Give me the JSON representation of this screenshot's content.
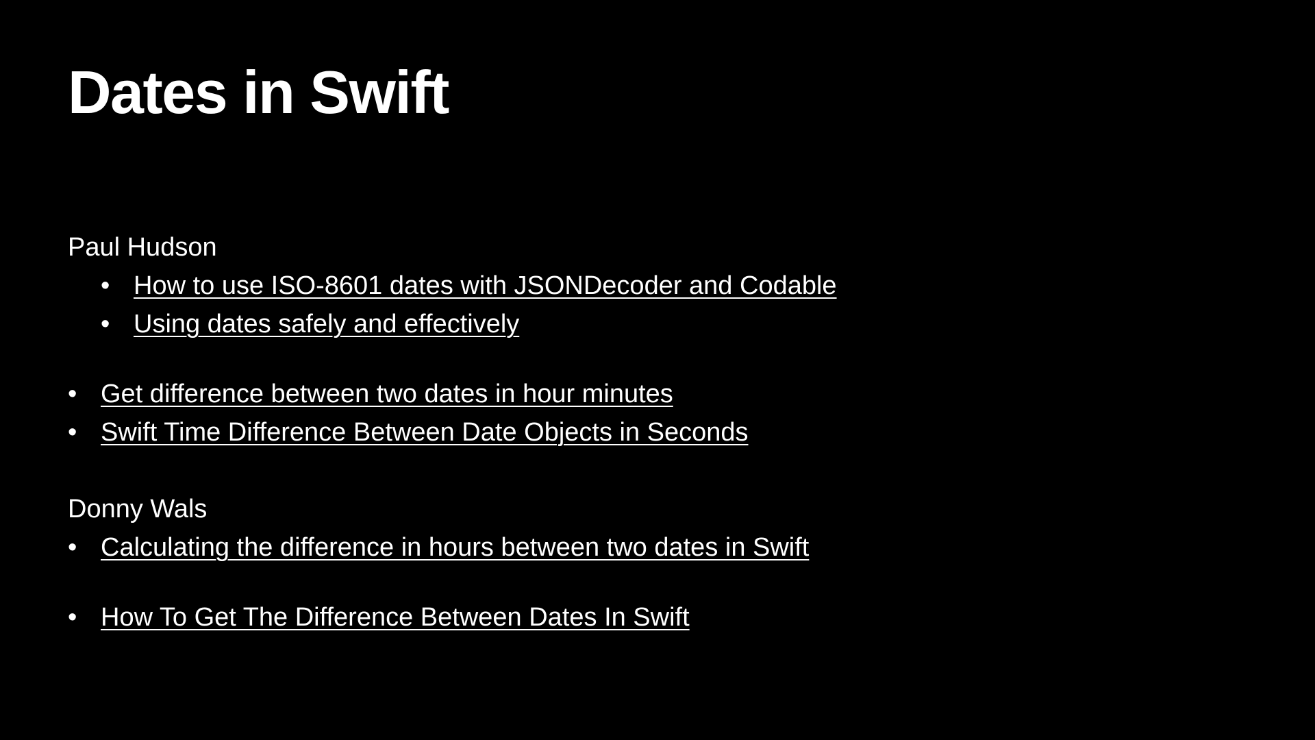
{
  "slide": {
    "title": "Dates in Swift",
    "bullet_glyph": "•",
    "sections": [
      {
        "heading": "Paul Hudson",
        "links": [
          "How to use ISO-8601 dates with JSONDecoder and Codable",
          "Using dates safely and effectively"
        ]
      },
      {
        "links": [
          "Get difference between two dates in hour minutes",
          "Swift Time Difference Between Date Objects in Seconds"
        ]
      },
      {
        "heading": "Donny Wals",
        "links": [
          "Calculating the difference in hours between two dates in Swift"
        ]
      },
      {
        "links": [
          "How To Get The Difference Between Dates In Swift"
        ]
      }
    ]
  },
  "colors": {
    "background": "#000000",
    "text": "#ffffff"
  }
}
